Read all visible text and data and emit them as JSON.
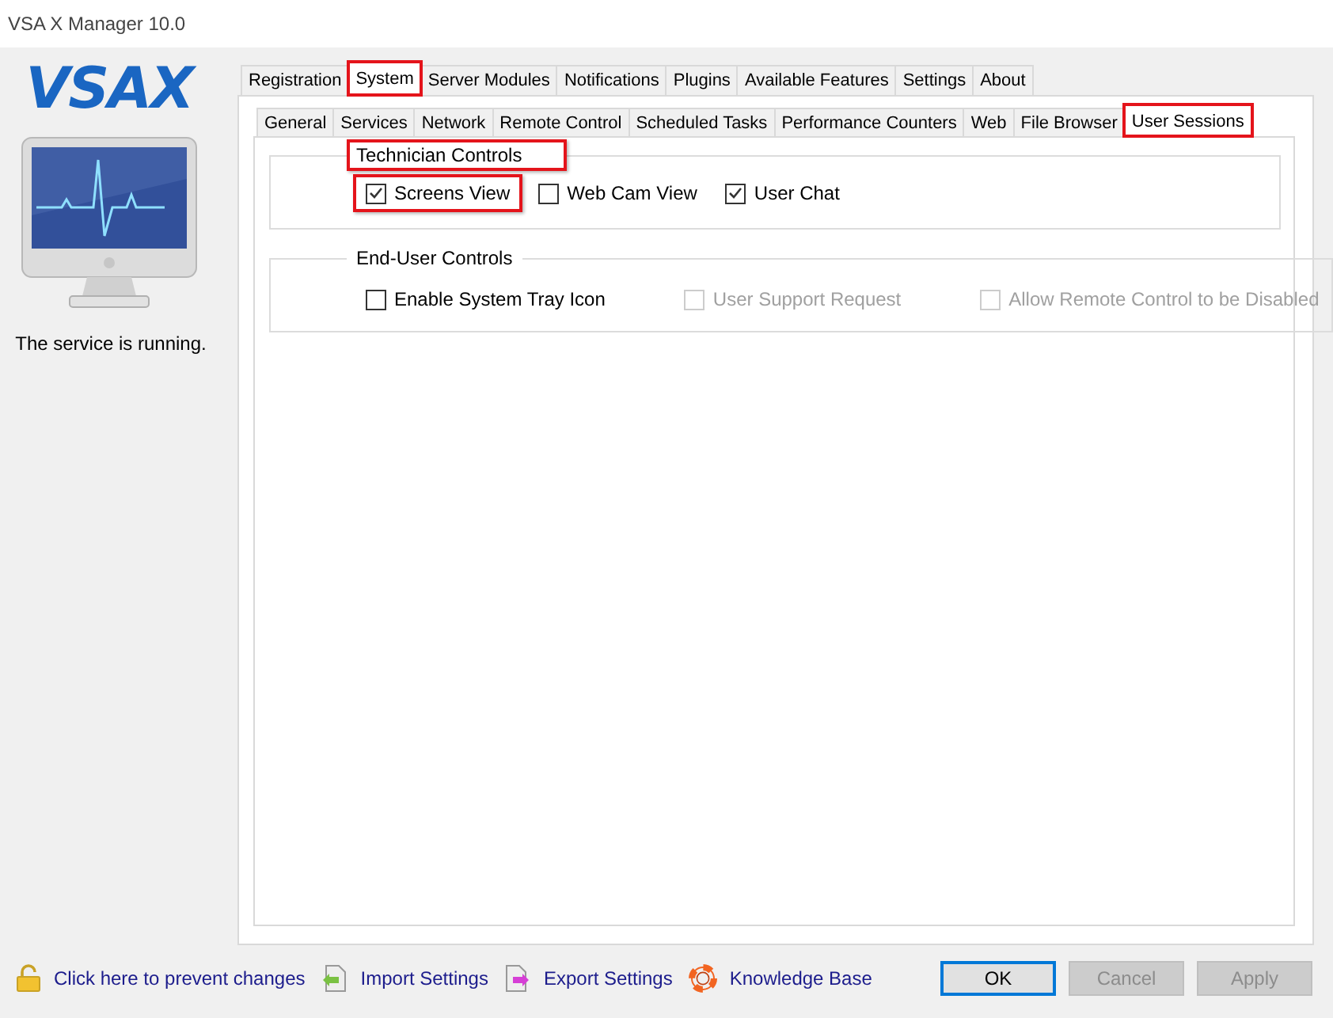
{
  "window": {
    "title": "VSA X Manager 10.0"
  },
  "sidebar": {
    "logo": "VSAX",
    "status": "The service is running."
  },
  "tabs": [
    {
      "label": "Registration",
      "selected": false,
      "highlighted": false
    },
    {
      "label": "System",
      "selected": true,
      "highlighted": true
    },
    {
      "label": "Server Modules",
      "selected": false,
      "highlighted": false
    },
    {
      "label": "Notifications",
      "selected": false,
      "highlighted": false
    },
    {
      "label": "Plugins",
      "selected": false,
      "highlighted": false
    },
    {
      "label": "Available Features",
      "selected": false,
      "highlighted": false
    },
    {
      "label": "Settings",
      "selected": false,
      "highlighted": false
    },
    {
      "label": "About",
      "selected": false,
      "highlighted": false
    }
  ],
  "subtabs": [
    {
      "label": "General",
      "selected": false,
      "highlighted": false
    },
    {
      "label": "Services",
      "selected": false,
      "highlighted": false
    },
    {
      "label": "Network",
      "selected": false,
      "highlighted": false
    },
    {
      "label": "Remote Control",
      "selected": false,
      "highlighted": false
    },
    {
      "label": "Scheduled Tasks",
      "selected": false,
      "highlighted": false
    },
    {
      "label": "Performance Counters",
      "selected": false,
      "highlighted": false
    },
    {
      "label": "Web",
      "selected": false,
      "highlighted": false
    },
    {
      "label": "File Browser",
      "selected": false,
      "highlighted": false
    },
    {
      "label": "User Sessions",
      "selected": true,
      "highlighted": true
    }
  ],
  "groups": [
    {
      "title": "Technician Controls",
      "highlighted": true,
      "options": [
        {
          "label": "Screens View",
          "checked": true,
          "disabled": false,
          "highlighted": true
        },
        {
          "label": "Web Cam View",
          "checked": false,
          "disabled": false,
          "highlighted": false
        },
        {
          "label": "User Chat",
          "checked": true,
          "disabled": false,
          "highlighted": false
        }
      ]
    },
    {
      "title": "End-User Controls",
      "highlighted": false,
      "options": [
        {
          "label": "Enable System Tray Icon",
          "checked": false,
          "disabled": false,
          "highlighted": false
        },
        {
          "label": "User Support Request",
          "checked": false,
          "disabled": true,
          "highlighted": false
        },
        {
          "label": "Allow Remote Control to be Disabled",
          "checked": false,
          "disabled": true,
          "highlighted": false
        }
      ]
    }
  ],
  "footer_links": [
    {
      "label": "Click here to prevent changes",
      "kind": "lock"
    },
    {
      "label": "Import Settings",
      "kind": "import"
    },
    {
      "label": "Export Settings",
      "kind": "export"
    },
    {
      "label": "Knowledge Base",
      "kind": "help"
    }
  ],
  "buttons": [
    {
      "label": "OK",
      "disabled": false,
      "default": true
    },
    {
      "label": "Cancel",
      "disabled": true,
      "default": false
    },
    {
      "label": "Apply",
      "disabled": true,
      "default": false
    }
  ]
}
